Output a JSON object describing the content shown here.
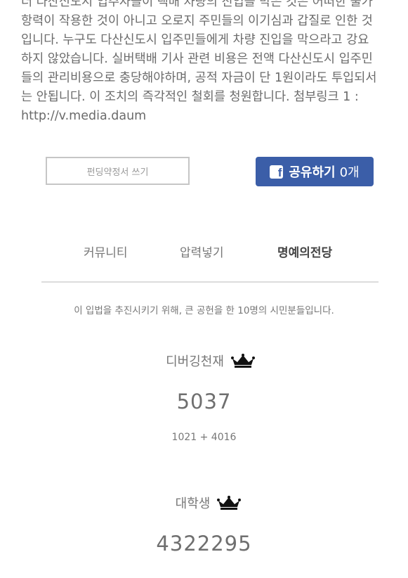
{
  "article": {
    "lines": [
      "더 다산신도시 입주자들이 택배 차량의 진입을 막은 것은 어떠한 불가",
      "항력이 작용한 것이 아니고 오로지 주민들의 이기심과 갑질로 인한 것",
      "입니다. 누구도 다산신도시 입주민들에게 차량 진입을 막으라고 강요",
      "하지 않았습니다. 실버택배 기사 관련 비용은 전액 다산신도시 입주민",
      "들의 관리비용으로 충당해야하며, 공적 자금이 단 1원이라도 투입되서",
      "는 안됩니다. 이 조치의 즉각적인 철회를 청원합니다. 첨부링크 1 :",
      "http://v.media.daum"
    ]
  },
  "actions": {
    "pledge_label": "펀딩약정서 쓰기",
    "share_label": "공유하기",
    "share_count": "0개",
    "share_icon": "facebook-f-icon",
    "share_color": "#3b5ea8"
  },
  "tabs": [
    {
      "label": "커뮤니티",
      "active": false
    },
    {
      "label": "압력넣기",
      "active": false
    },
    {
      "label": "명예의전당",
      "active": true
    }
  ],
  "hall_of_fame": {
    "intro": "이 입법을 추진시키기 위해, 큰 공헌을 한 10명의 시민분들입니다.",
    "entries": [
      {
        "name": "디버깅천재",
        "score": "5037",
        "breakdown": "1021 + 4016",
        "icon": "crown-icon"
      },
      {
        "name": "대학생",
        "score": "4322295",
        "icon": "crown-icon"
      }
    ]
  }
}
